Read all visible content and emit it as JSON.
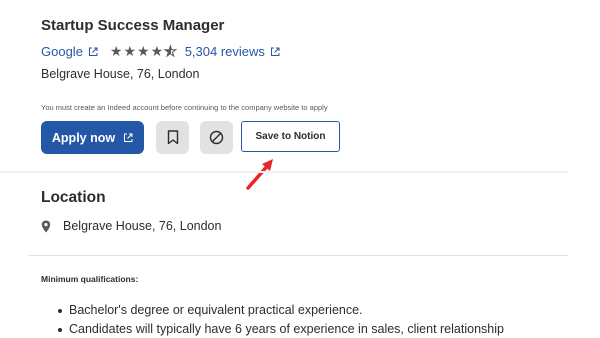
{
  "job": {
    "title": "Startup Success Manager",
    "company": "Google",
    "rating_value": 4.5,
    "rating_stars": "★★★★",
    "rating_half_star": "★",
    "reviews": "5,304 reviews",
    "address": "Belgrave House, 76, London"
  },
  "notice": "You must create an Indeed account before continuing to the company website to apply",
  "actions": {
    "apply_label": "Apply now",
    "save_to_notion_label": "Save to Notion"
  },
  "location": {
    "heading": "Location",
    "address": "Belgrave House, 76, London"
  },
  "qualifications": {
    "heading": "Minimum qualifications:",
    "items": [
      "Bachelor's degree or equivalent practical experience.",
      "Candidates will typically have 6 years of experience in sales, client relationship"
    ]
  },
  "colors": {
    "link": "#2557a7",
    "primary_button": "#2557a7",
    "icon_button_bg": "#e4e2e0",
    "arrow_annotation": "#e8262a"
  },
  "icons": {
    "external_link": "external-link-icon",
    "bookmark": "bookmark-icon",
    "not_interested": "not-interested-icon",
    "location_pin": "location-pin-icon"
  }
}
